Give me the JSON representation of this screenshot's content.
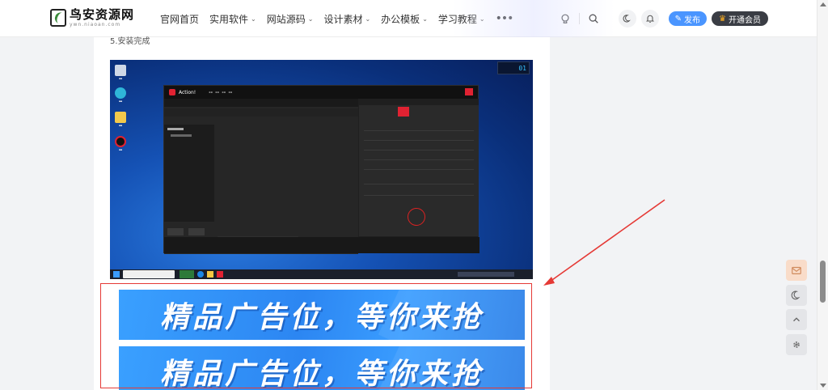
{
  "header": {
    "logo_text": "鸟安资源网",
    "logo_sub": "ywn.niaoan.com",
    "nav": [
      {
        "label": "官网首页",
        "has_dropdown": false
      },
      {
        "label": "实用软件",
        "has_dropdown": true
      },
      {
        "label": "网站源码",
        "has_dropdown": true
      },
      {
        "label": "设计素材",
        "has_dropdown": true
      },
      {
        "label": "办公模板",
        "has_dropdown": true
      },
      {
        "label": "学习教程",
        "has_dropdown": true
      }
    ],
    "more_label": "•••",
    "publish_label": "发布",
    "vip_label": "开通会员"
  },
  "article": {
    "step_text": "5.安装完成",
    "screenshot": {
      "fps_label": "01",
      "app_name": "Action!"
    },
    "ads": [
      {
        "text": "精品广告位，等你来抢"
      },
      {
        "text": "精品广告位，等你来抢"
      }
    ]
  },
  "annotations": {
    "color": "#e53935"
  },
  "floating_tools": [
    "mail-icon",
    "moon-icon",
    "arrow-up-icon",
    "gear-icon"
  ],
  "colors": {
    "accent": "#4a95ff",
    "vip": "#3a3d44",
    "ad_blue": "#2c86f2",
    "mail_bg": "#f9dcc9"
  }
}
